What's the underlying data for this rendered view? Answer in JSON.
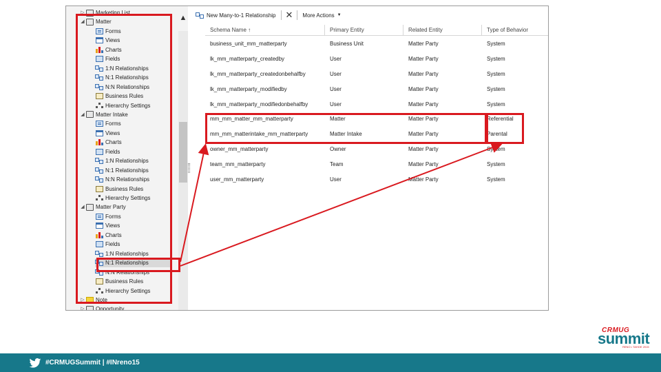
{
  "tree": {
    "items": [
      {
        "toggle": "▷",
        "icon": "entity-icon",
        "label": "Marketing List",
        "indent": 0
      },
      {
        "toggle": "◢",
        "icon": "entity-icon",
        "label": "Matter",
        "indent": 0
      },
      {
        "toggle": "",
        "icon": "forms-icon",
        "label": "Forms",
        "indent": 1
      },
      {
        "toggle": "",
        "icon": "views-icon",
        "label": "Views",
        "indent": 1
      },
      {
        "toggle": "",
        "icon": "charts-icon",
        "label": "Charts",
        "indent": 1
      },
      {
        "toggle": "",
        "icon": "fields-icon",
        "label": "Fields",
        "indent": 1
      },
      {
        "toggle": "",
        "icon": "relationship-icon",
        "label": "1:N Relationships",
        "indent": 1
      },
      {
        "toggle": "",
        "icon": "relationship-icon",
        "label": "N:1 Relationships",
        "indent": 1
      },
      {
        "toggle": "",
        "icon": "relationship-icon",
        "label": "N:N Relationships",
        "indent": 1
      },
      {
        "toggle": "",
        "icon": "business-rules-icon",
        "label": "Business Rules",
        "indent": 1
      },
      {
        "toggle": "",
        "icon": "hierarchy-icon",
        "label": "Hierarchy Settings",
        "indent": 1
      },
      {
        "toggle": "◢",
        "icon": "entity-icon",
        "label": "Matter Intake",
        "indent": 0
      },
      {
        "toggle": "",
        "icon": "forms-icon",
        "label": "Forms",
        "indent": 1
      },
      {
        "toggle": "",
        "icon": "views-icon",
        "label": "Views",
        "indent": 1
      },
      {
        "toggle": "",
        "icon": "charts-icon",
        "label": "Charts",
        "indent": 1
      },
      {
        "toggle": "",
        "icon": "fields-icon",
        "label": "Fields",
        "indent": 1
      },
      {
        "toggle": "",
        "icon": "relationship-icon",
        "label": "1:N Relationships",
        "indent": 1
      },
      {
        "toggle": "",
        "icon": "relationship-icon",
        "label": "N:1 Relationships",
        "indent": 1
      },
      {
        "toggle": "",
        "icon": "relationship-icon",
        "label": "N:N Relationships",
        "indent": 1
      },
      {
        "toggle": "",
        "icon": "business-rules-icon",
        "label": "Business Rules",
        "indent": 1
      },
      {
        "toggle": "",
        "icon": "hierarchy-icon",
        "label": "Hierarchy Settings",
        "indent": 1
      },
      {
        "toggle": "◢",
        "icon": "entity-icon",
        "label": "Matter Party",
        "indent": 0
      },
      {
        "toggle": "",
        "icon": "forms-icon",
        "label": "Forms",
        "indent": 1
      },
      {
        "toggle": "",
        "icon": "views-icon",
        "label": "Views",
        "indent": 1
      },
      {
        "toggle": "",
        "icon": "charts-icon",
        "label": "Charts",
        "indent": 1
      },
      {
        "toggle": "",
        "icon": "fields-icon",
        "label": "Fields",
        "indent": 1
      },
      {
        "toggle": "",
        "icon": "relationship-icon",
        "label": "1:N Relationships",
        "indent": 1
      },
      {
        "toggle": "",
        "icon": "relationship-icon",
        "label": "N:1 Relationships",
        "indent": 1,
        "selected": true
      },
      {
        "toggle": "",
        "icon": "relationship-icon",
        "label": "N:N Relationships",
        "indent": 1
      },
      {
        "toggle": "",
        "icon": "business-rules-icon",
        "label": "Business Rules",
        "indent": 1
      },
      {
        "toggle": "",
        "icon": "hierarchy-icon",
        "label": "Hierarchy Settings",
        "indent": 1
      },
      {
        "toggle": "▷",
        "icon": "note-icon",
        "label": "Note",
        "indent": 0
      },
      {
        "toggle": "▷",
        "icon": "entity-icon",
        "label": "Opportunity",
        "indent": 0
      }
    ],
    "scroll_up_glyph": "▲"
  },
  "toolbar": {
    "new_label": "New Many-to-1 Relationship",
    "delete_glyph": "✕",
    "more_label": "More Actions",
    "more_caret": "▼"
  },
  "grid": {
    "columns": [
      "Schema Name ↑",
      "Primary Entity",
      "Related Entity",
      "Type of Behavior"
    ],
    "rows": [
      [
        "business_unit_mm_matterparty",
        "Business Unit",
        "Matter Party",
        "System"
      ],
      [
        "lk_mm_matterparty_createdby",
        "User",
        "Matter Party",
        "System"
      ],
      [
        "lk_mm_matterparty_createdonbehalfby",
        "User",
        "Matter Party",
        "System"
      ],
      [
        "lk_mm_matterparty_modifiedby",
        "User",
        "Matter Party",
        "System"
      ],
      [
        "lk_mm_matterparty_modifiedonbehalfby",
        "User",
        "Matter Party",
        "System"
      ],
      [
        "mm_mm_matter_mm_matterparty",
        "Matter",
        "Matter Party",
        "Referential"
      ],
      [
        "mm_mm_matterintake_mm_matterparty",
        "Matter Intake",
        "Matter Party",
        "Parental"
      ],
      [
        "owner_mm_matterparty",
        "Owner",
        "Matter Party",
        "System"
      ],
      [
        "team_mm_matterparty",
        "Team",
        "Matter Party",
        "System"
      ],
      [
        "user_mm_matterparty",
        "User",
        "Matter Party",
        "System"
      ]
    ]
  },
  "footer": {
    "hashtags": "#CRMUGSummit | #INreno15",
    "bg_color": "#17788a"
  },
  "logo": {
    "top": "CRMUG",
    "main": "summit",
    "sub": "RENO • TAHOE 2015"
  },
  "colors": {
    "annotation_red": "#d9191f"
  }
}
